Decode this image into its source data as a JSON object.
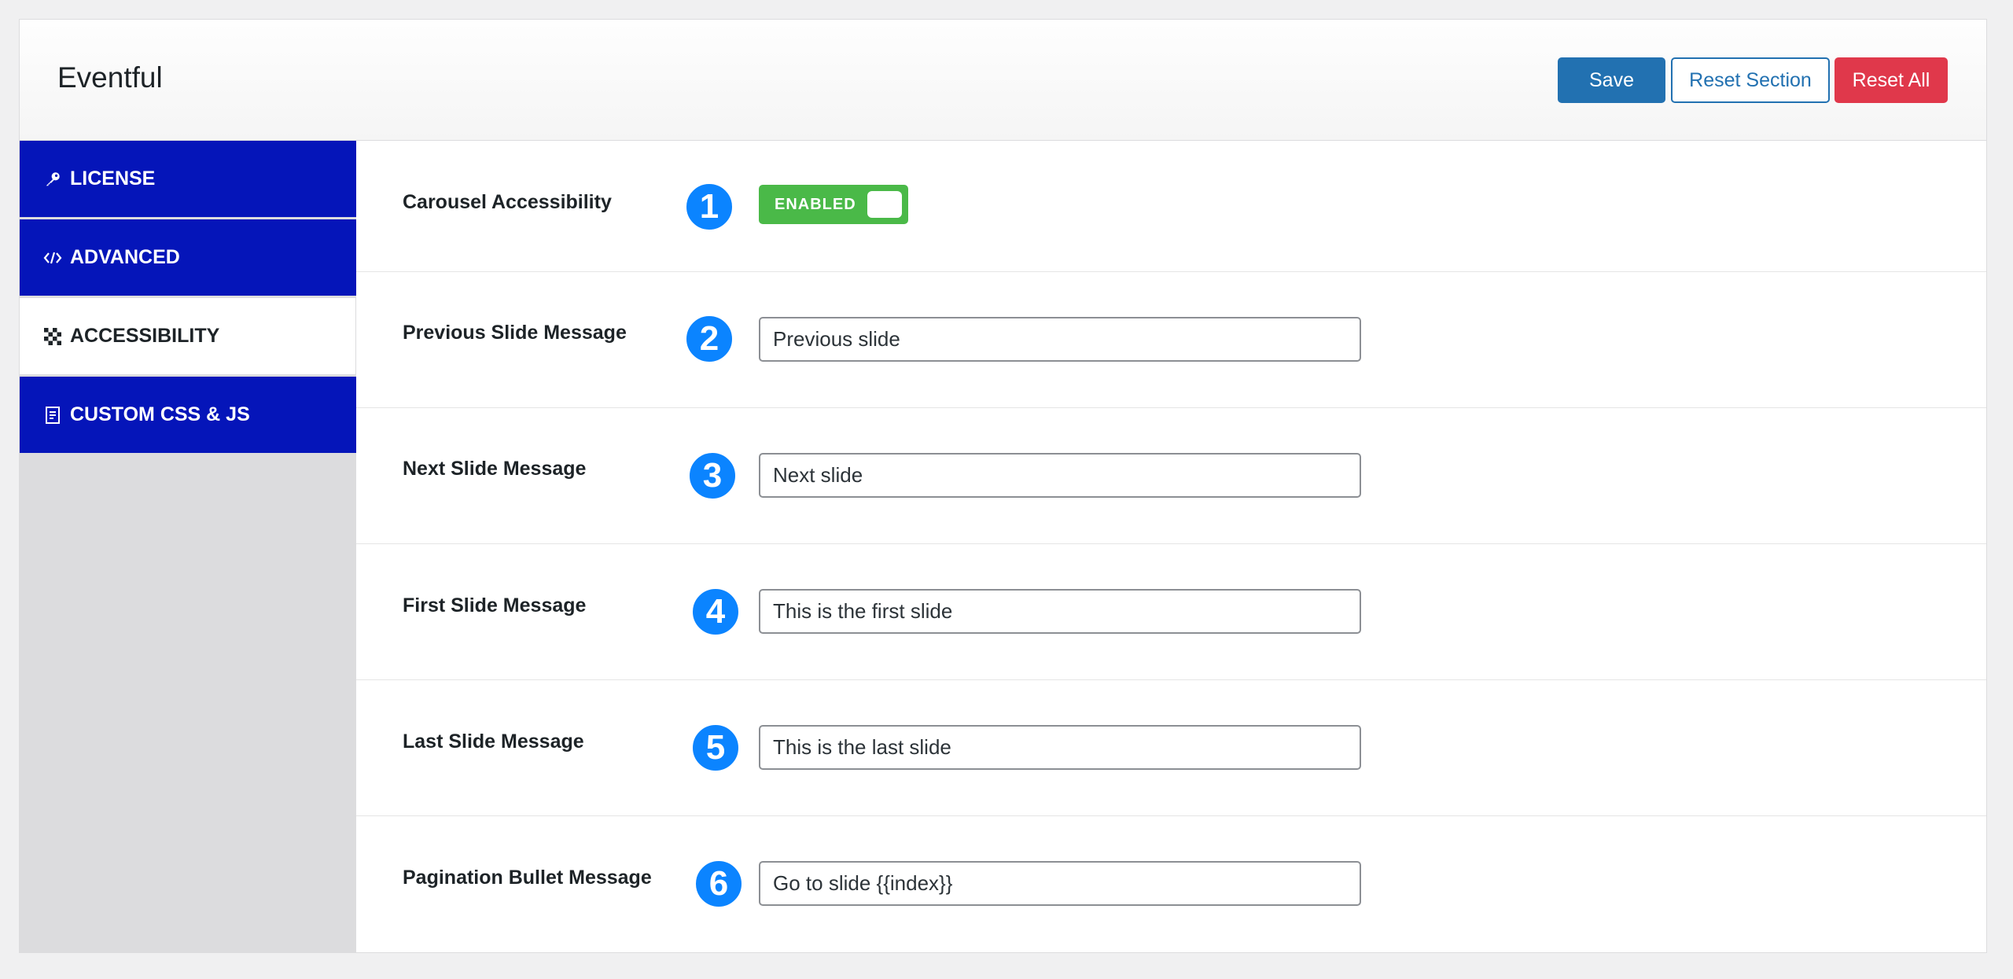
{
  "header": {
    "title": "Eventful",
    "save_label": "Save",
    "reset_section_label": "Reset Section",
    "reset_all_label": "Reset All"
  },
  "sidebar": {
    "items": [
      {
        "label": "LICENSE",
        "icon": "key-icon",
        "active": false
      },
      {
        "label": "ADVANCED",
        "icon": "code-icon",
        "active": false
      },
      {
        "label": "ACCESSIBILITY",
        "icon": "checkerboard-icon",
        "active": true
      },
      {
        "label": "CUSTOM CSS & JS",
        "icon": "file-code-icon",
        "active": false
      }
    ]
  },
  "fields": {
    "carousel_accessibility": {
      "label": "Carousel Accessibility",
      "badge": "1",
      "toggle_label": "ENABLED"
    },
    "previous_slide": {
      "label": "Previous Slide Message",
      "badge": "2",
      "value": "Previous slide"
    },
    "next_slide": {
      "label": "Next Slide Message",
      "badge": "3",
      "value": "Next slide"
    },
    "first_slide": {
      "label": "First Slide Message",
      "badge": "4",
      "value": "This is the first slide"
    },
    "last_slide": {
      "label": "Last Slide Message",
      "badge": "5",
      "value": "This is the last slide"
    },
    "pagination_bullet": {
      "label": "Pagination Bullet Message",
      "badge": "6",
      "value": "Go to slide {{index}}"
    }
  },
  "colors": {
    "sidebar_nav": "#0515b9",
    "primary_button": "#2271b1",
    "danger_button": "#e0384b",
    "toggle_on": "#4ab948",
    "badge": "#0b84ff"
  }
}
